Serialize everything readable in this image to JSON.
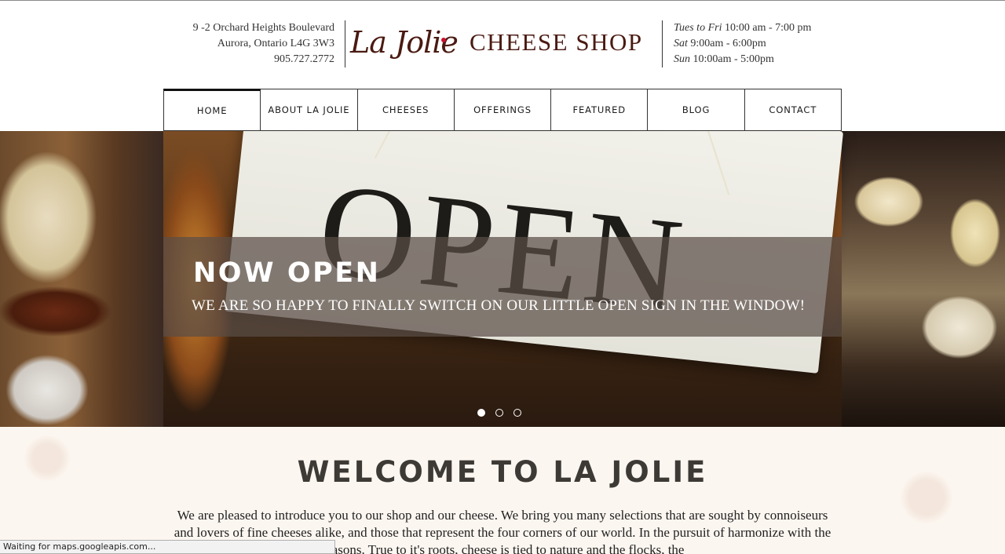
{
  "header": {
    "address": [
      "9 -2 Orchard Heights Boulevard",
      "Aurora, Ontario L4G 3W3",
      "905.727.2772"
    ],
    "logo_script": "La Jolie",
    "logo_text": "CHEESE SHOP",
    "hours": [
      {
        "days": "Tues to Fri",
        "time": "10:00 am - 7:00 pm"
      },
      {
        "days": "Sat",
        "time": "9:00am - 6:00pm"
      },
      {
        "days": "Sun",
        "time": "10:00am - 5:00pm"
      }
    ]
  },
  "nav": {
    "items": [
      "HOME",
      "ABOUT LA JOLIE",
      "CHEESES",
      "OFFERINGS",
      "FEATURED",
      "BLOG",
      "CONTACT"
    ],
    "active": "HOME"
  },
  "hero": {
    "sign_word": "OPEN",
    "title": "NOW OPEN",
    "subtitle": "WE ARE SO HAPPY TO FINALLY SWITCH ON OUR LITTLE OPEN SIGN IN THE WINDOW!",
    "slide_count": 3,
    "active_slide": 1
  },
  "welcome": {
    "title": "WELCOME TO LA JOLIE",
    "body": "We are pleased to introduce you to our shop and our cheese. We bring you many selections that are sought by connoiseurs and lovers of fine cheeses alike, and those that represent the four corners of our world. In the pursuit of harmonize with the seasons. True to it's roots, cheese is tied to nature and the flocks, the"
  },
  "status_bar": "Waiting for maps.googleapis.com...",
  "colors": {
    "brand": "#4a1a12",
    "accent_dot": "#c8102e",
    "caption_overlay": "#5a4e46",
    "welcome_bg": "#fcf6f0"
  }
}
